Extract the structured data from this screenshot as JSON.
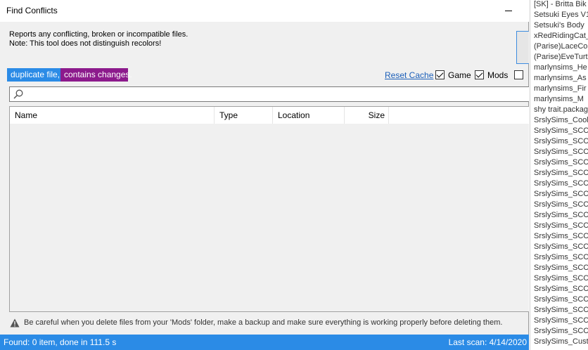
{
  "window": {
    "title": "Find Conflicts",
    "description_line1": "Reports any conflicting, broken or incompatible files.",
    "description_line2": "Note: This tool does not distinguish recolors!"
  },
  "legend": {
    "duplicate": "duplicate file,",
    "duplicate_color": "#2b8be6",
    "changes": "contains changes.",
    "changes_color": "#8c1a8c"
  },
  "toolbar": {
    "reset_cache": "Reset Cache",
    "game_label": "Game",
    "game_checked": true,
    "mods_label": "Mods",
    "mods_checked": true,
    "other_checked": false
  },
  "search": {
    "value": ""
  },
  "table": {
    "columns": [
      "Name",
      "Type",
      "Location",
      "Size"
    ],
    "rows": []
  },
  "warning": "Be careful when you delete files from your 'Mods' folder, make a backup and make sure everything is working properly before deleting them.",
  "status": {
    "left": "Found: 0 item, done in 111.5 s",
    "right": "Last scan: 4/14/2020"
  },
  "background_files": [
    "[SK] - Britta Bik",
    "Setsuki Eyes V1",
    "Setsuki's Body",
    "xRedRidingCat_",
    "(Parise)LaceCo",
    "(Parise)EveTurt",
    "marlynsims_He",
    "marlynsims_As",
    "marlynsims_Fir",
    "marlynsims_M",
    "shy trait.packag",
    "SrslySims_Cool",
    "SrslySims_SCC",
    "SrslySims_SCC",
    "SrslySims_SCC",
    "SrslySims_SCC",
    "SrslySims_SCC",
    "SrslySims_SCC",
    "SrslySims_SCC",
    "SrslySims_SCC",
    "SrslySims_SCC",
    "SrslySims_SCC",
    "SrslySims_SCC",
    "SrslySims_SCC",
    "SrslySims_SCC",
    "SrslySims_SCC",
    "SrslySims_SCC",
    "SrslySims_SCC",
    "SrslySims_SCC",
    "SrslySims_SCC",
    "SrslySims_SCC",
    "SrslySims_SCC",
    "SrslySims_Cust"
  ]
}
